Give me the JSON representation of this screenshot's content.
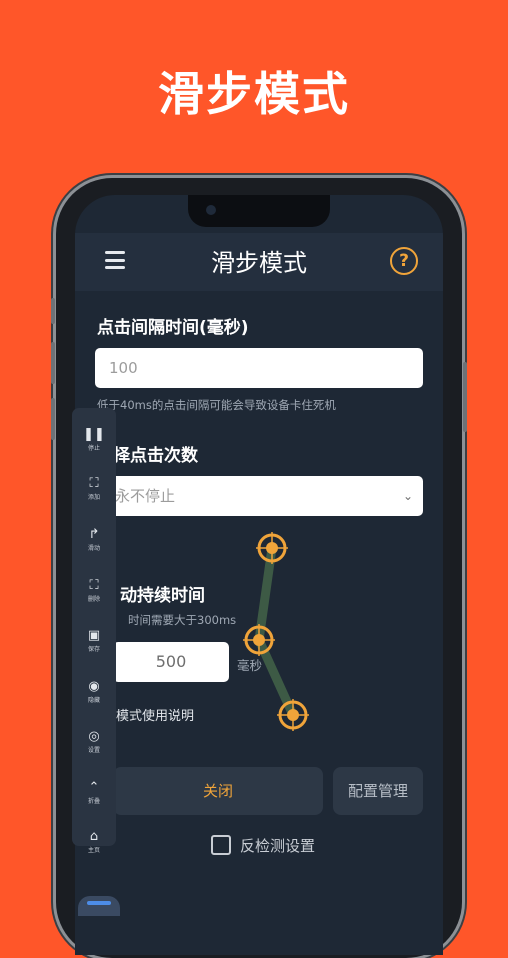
{
  "promo_title": "滑步模式",
  "app_bar": {
    "title": "滑步模式",
    "help_glyph": "?"
  },
  "interval": {
    "label": "点击间隔时间(毫秒)",
    "value": "100",
    "hint": "低于40ms的点击间隔可能会导致设备卡住死机"
  },
  "click_count": {
    "label": "择点击次数",
    "selected": "永不停止"
  },
  "duration": {
    "label": "动持续时间",
    "hint": "时间需要大于300ms",
    "value": "500",
    "unit": "毫秒"
  },
  "guide_link": "模式使用说明",
  "buttons": {
    "close": "关闭",
    "config": "配置管理"
  },
  "anti_detect": "反检测设置",
  "toolbar": [
    {
      "icon": "pause-icon",
      "glyph": "❚❚",
      "label": "停止"
    },
    {
      "icon": "add-target-icon",
      "glyph": "⛶",
      "label": "添加"
    },
    {
      "icon": "swipe-icon",
      "glyph": "↱",
      "label": "滑动"
    },
    {
      "icon": "remove-target-icon",
      "glyph": "⛶",
      "label": "删除"
    },
    {
      "icon": "save-icon",
      "glyph": "▣",
      "label": "保存"
    },
    {
      "icon": "eye-icon",
      "glyph": "◉",
      "label": "隐藏"
    },
    {
      "icon": "settings-icon",
      "glyph": "◎",
      "label": "设置"
    },
    {
      "icon": "collapse-icon",
      "glyph": "⌃",
      "label": "折叠"
    },
    {
      "icon": "home-icon",
      "glyph": "⌂",
      "label": "主页"
    }
  ],
  "colors": {
    "background": "#FF5629",
    "accent_orange": "#F0A43A",
    "screen": "#1E2835",
    "close_text": "#F0A43A"
  }
}
